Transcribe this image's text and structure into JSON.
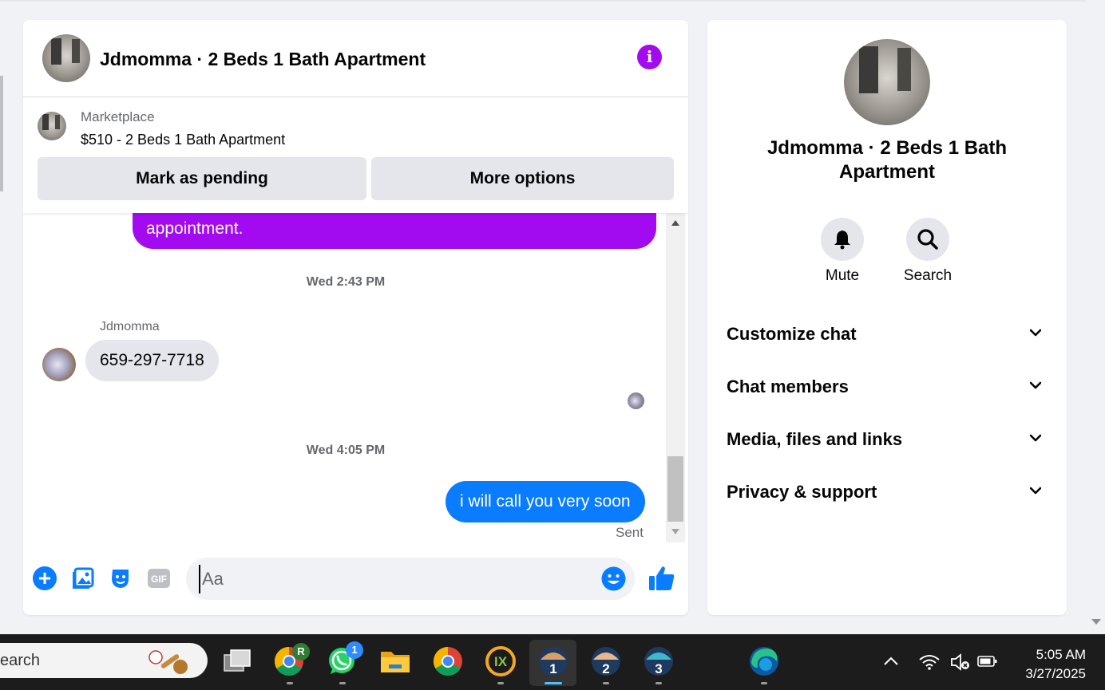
{
  "chat": {
    "title": "Jdmomma · 2 Beds 1 Bath Apartment",
    "listing": {
      "kind": "Marketplace",
      "price_title": "$510 - 2 Beds 1 Bath Apartment",
      "mark_pending_label": "Mark as pending",
      "more_options_label": "More options"
    },
    "messages": {
      "partial_outgoing_text": "appointment.",
      "timestamp_1": "Wed 2:43 PM",
      "sender_name": "Jdmomma",
      "incoming_text": "659-297-7718",
      "timestamp_2": "Wed 4:05 PM",
      "outgoing_text": "i will call you very soon",
      "status": "Sent"
    },
    "composer": {
      "placeholder": "Aa",
      "gif_label": "GIF"
    },
    "colors": {
      "accent_purple": "#a20bf0",
      "outgoing_blue": "#0a7cff",
      "messenger_blue": "#0866ff"
    }
  },
  "side_panel": {
    "title": "Jdmomma · 2 Beds 1 Bath Apartment",
    "actions": [
      {
        "label": "Mute",
        "icon": "bell-icon"
      },
      {
        "label": "Search",
        "icon": "search-icon"
      }
    ],
    "sections": [
      {
        "label": "Customize chat"
      },
      {
        "label": "Chat members"
      },
      {
        "label": "Media, files and links"
      },
      {
        "label": "Privacy & support"
      }
    ]
  },
  "taskbar": {
    "search_text": "earch",
    "apps": [
      {
        "name": "task-view-icon"
      },
      {
        "name": "chrome-icon",
        "badge": "R"
      },
      {
        "name": "whatsapp-icon",
        "badge": "1"
      },
      {
        "name": "file-explorer-icon"
      },
      {
        "name": "chrome-icon"
      },
      {
        "name": "ix-browser-icon"
      },
      {
        "name": "profile-app-icon",
        "number": "1"
      },
      {
        "name": "profile-app-icon",
        "number": "2"
      },
      {
        "name": "profile-app-icon",
        "number": "3"
      },
      {
        "name": "edge-icon"
      }
    ],
    "time": "5:05 AM",
    "date": "3/27/2025"
  }
}
